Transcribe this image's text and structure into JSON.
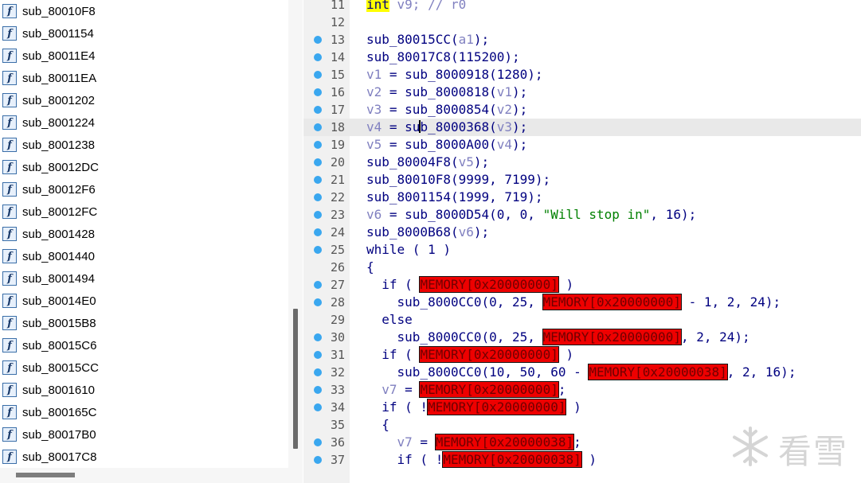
{
  "function_list": [
    "sub_80010F8",
    "sub_8001154",
    "sub_80011E4",
    "sub_80011EA",
    "sub_8001202",
    "sub_8001224",
    "sub_8001238",
    "sub_80012DC",
    "sub_80012F6",
    "sub_80012FC",
    "sub_8001428",
    "sub_8001440",
    "sub_8001494",
    "sub_80014E0",
    "sub_80015B8",
    "sub_80015C6",
    "sub_80015CC",
    "sub_8001610",
    "sub_800165C",
    "sub_80017B0",
    "sub_80017C8"
  ],
  "fn_icon_glyph": "f",
  "code_lines": [
    {
      "n": "11",
      "bp": false,
      "hl": false,
      "segs": [
        {
          "t": "int",
          "c": "kw"
        },
        {
          "t": " v9; // r0",
          "c": "var"
        }
      ]
    },
    {
      "n": "12",
      "bp": false,
      "hl": false,
      "segs": []
    },
    {
      "n": "13",
      "bp": true,
      "hl": false,
      "segs": [
        {
          "t": "sub_80015CC(",
          "c": ""
        },
        {
          "t": "a1",
          "c": "var"
        },
        {
          "t": ");",
          "c": ""
        }
      ]
    },
    {
      "n": "14",
      "bp": true,
      "hl": false,
      "segs": [
        {
          "t": "sub_80017C8(115200);",
          "c": ""
        }
      ]
    },
    {
      "n": "15",
      "bp": true,
      "hl": false,
      "segs": [
        {
          "t": "v1",
          "c": "var"
        },
        {
          "t": " = sub_8000918(1280);",
          "c": ""
        }
      ]
    },
    {
      "n": "16",
      "bp": true,
      "hl": false,
      "segs": [
        {
          "t": "v2",
          "c": "var"
        },
        {
          "t": " = sub_8000818(",
          "c": ""
        },
        {
          "t": "v1",
          "c": "var"
        },
        {
          "t": ");",
          "c": ""
        }
      ]
    },
    {
      "n": "17",
      "bp": true,
      "hl": false,
      "segs": [
        {
          "t": "v3",
          "c": "var"
        },
        {
          "t": " = sub_8000854(",
          "c": ""
        },
        {
          "t": "v2",
          "c": "var"
        },
        {
          "t": ");",
          "c": ""
        }
      ]
    },
    {
      "n": "18",
      "bp": true,
      "hl": true,
      "segs": [
        {
          "t": "v4",
          "c": "var"
        },
        {
          "t": " = su",
          "c": ""
        },
        {
          "t": "",
          "c": "caret"
        },
        {
          "t": "b_8000368(",
          "c": ""
        },
        {
          "t": "v3",
          "c": "var"
        },
        {
          "t": ");",
          "c": ""
        }
      ]
    },
    {
      "n": "19",
      "bp": true,
      "hl": false,
      "segs": [
        {
          "t": "v5",
          "c": "var"
        },
        {
          "t": " = sub_8000A00(",
          "c": ""
        },
        {
          "t": "v4",
          "c": "var"
        },
        {
          "t": ");",
          "c": ""
        }
      ]
    },
    {
      "n": "20",
      "bp": true,
      "hl": false,
      "segs": [
        {
          "t": "sub_80004F8(",
          "c": ""
        },
        {
          "t": "v5",
          "c": "var"
        },
        {
          "t": ");",
          "c": ""
        }
      ]
    },
    {
      "n": "21",
      "bp": true,
      "hl": false,
      "segs": [
        {
          "t": "sub_80010F8(9999, 7199);",
          "c": ""
        }
      ]
    },
    {
      "n": "22",
      "bp": true,
      "hl": false,
      "segs": [
        {
          "t": "sub_8001154(1999, 719);",
          "c": ""
        }
      ]
    },
    {
      "n": "23",
      "bp": true,
      "hl": false,
      "segs": [
        {
          "t": "v6",
          "c": "var"
        },
        {
          "t": " = sub_8000D54(0, 0, ",
          "c": ""
        },
        {
          "t": "\"Will stop in\"",
          "c": "str"
        },
        {
          "t": ", 16);",
          "c": ""
        }
      ]
    },
    {
      "n": "24",
      "bp": true,
      "hl": false,
      "segs": [
        {
          "t": "sub_8000B68(",
          "c": ""
        },
        {
          "t": "v6",
          "c": "var"
        },
        {
          "t": ");",
          "c": ""
        }
      ]
    },
    {
      "n": "25",
      "bp": true,
      "hl": false,
      "segs": [
        {
          "t": "while ( 1 )",
          "c": ""
        }
      ]
    },
    {
      "n": "26",
      "bp": false,
      "hl": false,
      "segs": [
        {
          "t": "{",
          "c": ""
        }
      ]
    },
    {
      "n": "27",
      "bp": true,
      "hl": false,
      "segs": [
        {
          "t": "  if ( ",
          "c": ""
        },
        {
          "t": "MEMORY[0x20000000]",
          "c": "mem"
        },
        {
          "t": " )",
          "c": ""
        }
      ]
    },
    {
      "n": "28",
      "bp": true,
      "hl": false,
      "segs": [
        {
          "t": "    sub_8000CC0(0, 25, ",
          "c": ""
        },
        {
          "t": "MEMORY[0x20000000]",
          "c": "mem"
        },
        {
          "t": " - 1, 2, 24);",
          "c": ""
        }
      ]
    },
    {
      "n": "29",
      "bp": false,
      "hl": false,
      "segs": [
        {
          "t": "  else",
          "c": ""
        }
      ]
    },
    {
      "n": "30",
      "bp": true,
      "hl": false,
      "segs": [
        {
          "t": "    sub_8000CC0(0, 25, ",
          "c": ""
        },
        {
          "t": "MEMORY[0x20000000]",
          "c": "mem"
        },
        {
          "t": ", 2, 24);",
          "c": ""
        }
      ]
    },
    {
      "n": "31",
      "bp": true,
      "hl": false,
      "segs": [
        {
          "t": "  if ( ",
          "c": ""
        },
        {
          "t": "MEMORY[0x20000000]",
          "c": "mem"
        },
        {
          "t": " )",
          "c": ""
        }
      ]
    },
    {
      "n": "32",
      "bp": true,
      "hl": false,
      "segs": [
        {
          "t": "    sub_8000CC0(10, 50, 60 - ",
          "c": ""
        },
        {
          "t": "MEMORY[0x20000038]",
          "c": "mem"
        },
        {
          "t": ", 2, 16);",
          "c": ""
        }
      ]
    },
    {
      "n": "33",
      "bp": true,
      "hl": false,
      "segs": [
        {
          "t": "  ",
          "c": ""
        },
        {
          "t": "v7",
          "c": "var"
        },
        {
          "t": " = ",
          "c": ""
        },
        {
          "t": "MEMORY[0x20000000]",
          "c": "mem"
        },
        {
          "t": ";",
          "c": ""
        }
      ]
    },
    {
      "n": "34",
      "bp": true,
      "hl": false,
      "segs": [
        {
          "t": "  if ( !",
          "c": ""
        },
        {
          "t": "MEMORY[0x20000000]",
          "c": "mem"
        },
        {
          "t": " )",
          "c": ""
        }
      ]
    },
    {
      "n": "35",
      "bp": false,
      "hl": false,
      "segs": [
        {
          "t": "  {",
          "c": ""
        }
      ]
    },
    {
      "n": "36",
      "bp": true,
      "hl": false,
      "segs": [
        {
          "t": "    ",
          "c": ""
        },
        {
          "t": "v7",
          "c": "var"
        },
        {
          "t": " = ",
          "c": ""
        },
        {
          "t": "MEMORY[0x20000038]",
          "c": "mem"
        },
        {
          "t": ";",
          "c": ""
        }
      ]
    },
    {
      "n": "37",
      "bp": true,
      "hl": false,
      "segs": [
        {
          "t": "    if ( !",
          "c": ""
        },
        {
          "t": "MEMORY[0x20000038]",
          "c": "mem"
        },
        {
          "t": " )",
          "c": ""
        }
      ]
    }
  ],
  "watermark": {
    "text": "看雪",
    "icon": "snowflake-logo"
  },
  "colors": {
    "breakpoint": "#3aa7ef",
    "memory_highlight": "#ee0000",
    "keyword_highlight": "#ffff00",
    "string": "#008000",
    "variable": "#8080c0",
    "code": "#000080"
  }
}
